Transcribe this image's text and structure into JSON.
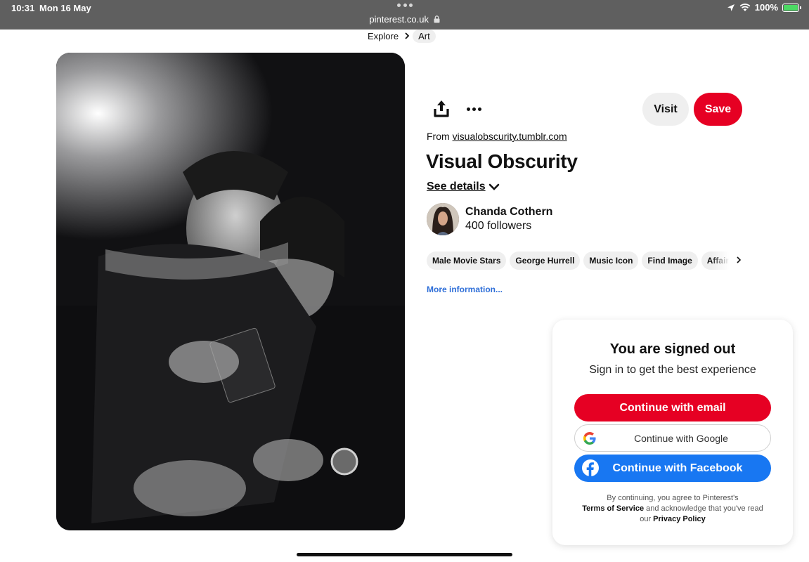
{
  "status_bar": {
    "time": "10:31",
    "date": "Mon 16 May",
    "url": "pinterest.co.uk",
    "battery": "100%"
  },
  "breadcrumb": {
    "items": [
      "Explore",
      "Art"
    ]
  },
  "pin": {
    "visit_label": "Visit",
    "save_label": "Save",
    "from_prefix": "From",
    "source_domain": "visualobscurity.tumblr.com",
    "title": "Visual Obscurity",
    "see_details": "See details",
    "author": {
      "name": "Chanda Cothern",
      "followers": "400 followers"
    },
    "tags": [
      "Male Movie Stars",
      "George Hurrell",
      "Music Icon",
      "Find Image",
      "Affair"
    ],
    "more_info": "More information..."
  },
  "signin": {
    "title": "You are signed out",
    "subtitle": "Sign in to get the best experience",
    "email_button": "Continue with email",
    "google_button": "Continue with Google",
    "facebook_button": "Continue with Facebook",
    "legal_1": "By continuing, you agree to Pinterest's",
    "terms": "Terms of Service",
    "legal_2": "and acknowledge that you've read",
    "legal_3": "our",
    "privacy": "Privacy Policy"
  },
  "colors": {
    "brand_red": "#e60023",
    "facebook_blue": "#1877f2",
    "link_blue": "#2f6fd8",
    "status_bar_bg": "#5f5f5f"
  },
  "icons": [
    "location-arrow-icon",
    "wifi-icon",
    "battery-icon",
    "lock-icon",
    "share-icon",
    "more-icon",
    "chevron-down-icon",
    "chevron-right-icon",
    "google-icon",
    "facebook-icon"
  ]
}
